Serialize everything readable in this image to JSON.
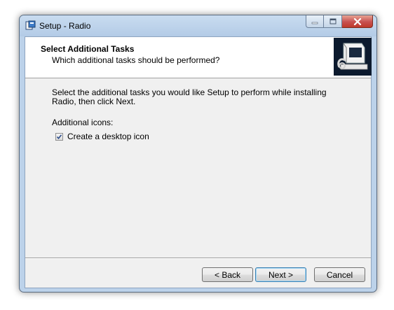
{
  "window": {
    "title": "Setup - Radio",
    "caption_buttons": [
      "minimize-icon",
      "maximize-icon",
      "close-icon"
    ]
  },
  "header": {
    "title": "Select Additional Tasks",
    "subtitle": "Which additional tasks should be performed?",
    "image_icon": "installer-computer-icon"
  },
  "body": {
    "description": "Select the additional tasks you would like Setup to perform while installing Radio, then click Next.",
    "group_label": "Additional icons:",
    "tasks": [
      {
        "label": "Create a desktop icon",
        "checked": true
      }
    ]
  },
  "buttons": {
    "back": "< Back",
    "next": "Next >",
    "cancel": "Cancel"
  },
  "colors": {
    "frame": "#bcd2ea",
    "client": "#f0f0f0",
    "close_button": "#c75050",
    "default_button_border": "#3c7fb1"
  }
}
